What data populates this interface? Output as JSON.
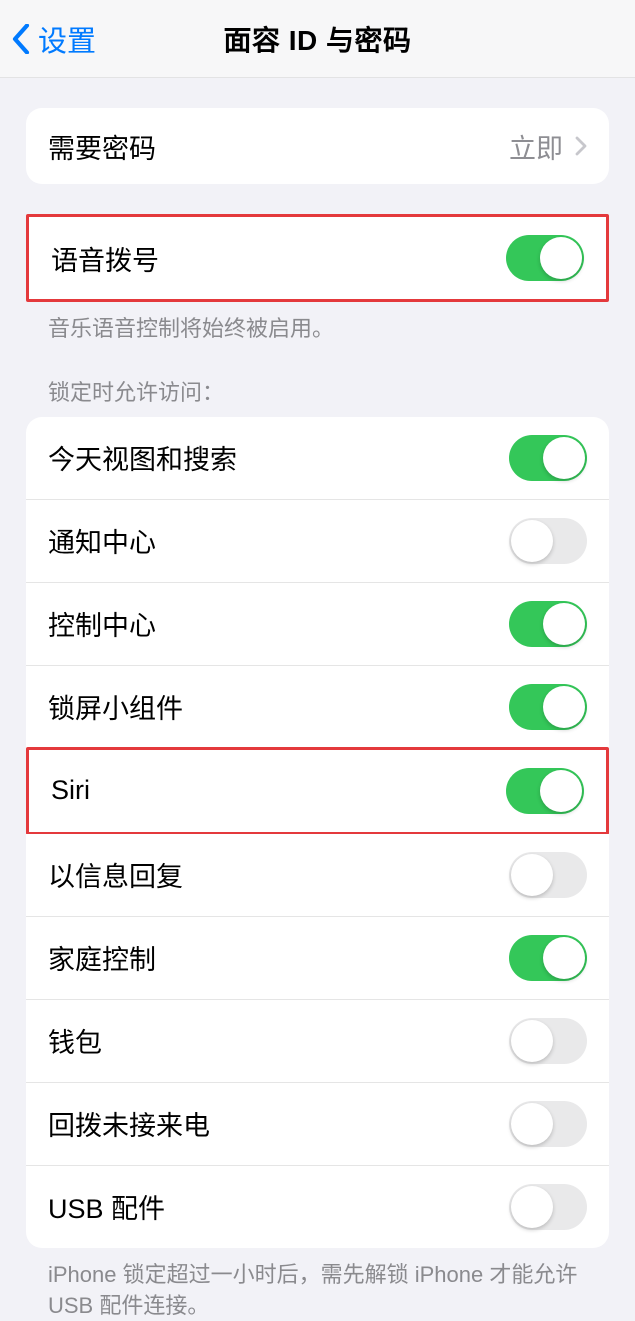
{
  "nav": {
    "back_label": "设置",
    "title": "面容 ID 与密码"
  },
  "require_passcode": {
    "label": "需要密码",
    "value": "立即"
  },
  "voice_dial": {
    "label": "语音拨号",
    "footer": "音乐语音控制将始终被启用。"
  },
  "locked_access": {
    "header": "锁定时允许访问：",
    "items": [
      {
        "label": "今天视图和搜索",
        "on": true
      },
      {
        "label": "通知中心",
        "on": false
      },
      {
        "label": "控制中心",
        "on": true
      },
      {
        "label": "锁屏小组件",
        "on": true
      },
      {
        "label": "Siri",
        "on": true
      },
      {
        "label": "以信息回复",
        "on": false
      },
      {
        "label": "家庭控制",
        "on": true
      },
      {
        "label": "钱包",
        "on": false
      },
      {
        "label": "回拨未接来电",
        "on": false
      },
      {
        "label": "USB 配件",
        "on": false
      }
    ],
    "footer": "iPhone 锁定超过一小时后，需先解锁 iPhone 才能允许 USB 配件连接。"
  }
}
